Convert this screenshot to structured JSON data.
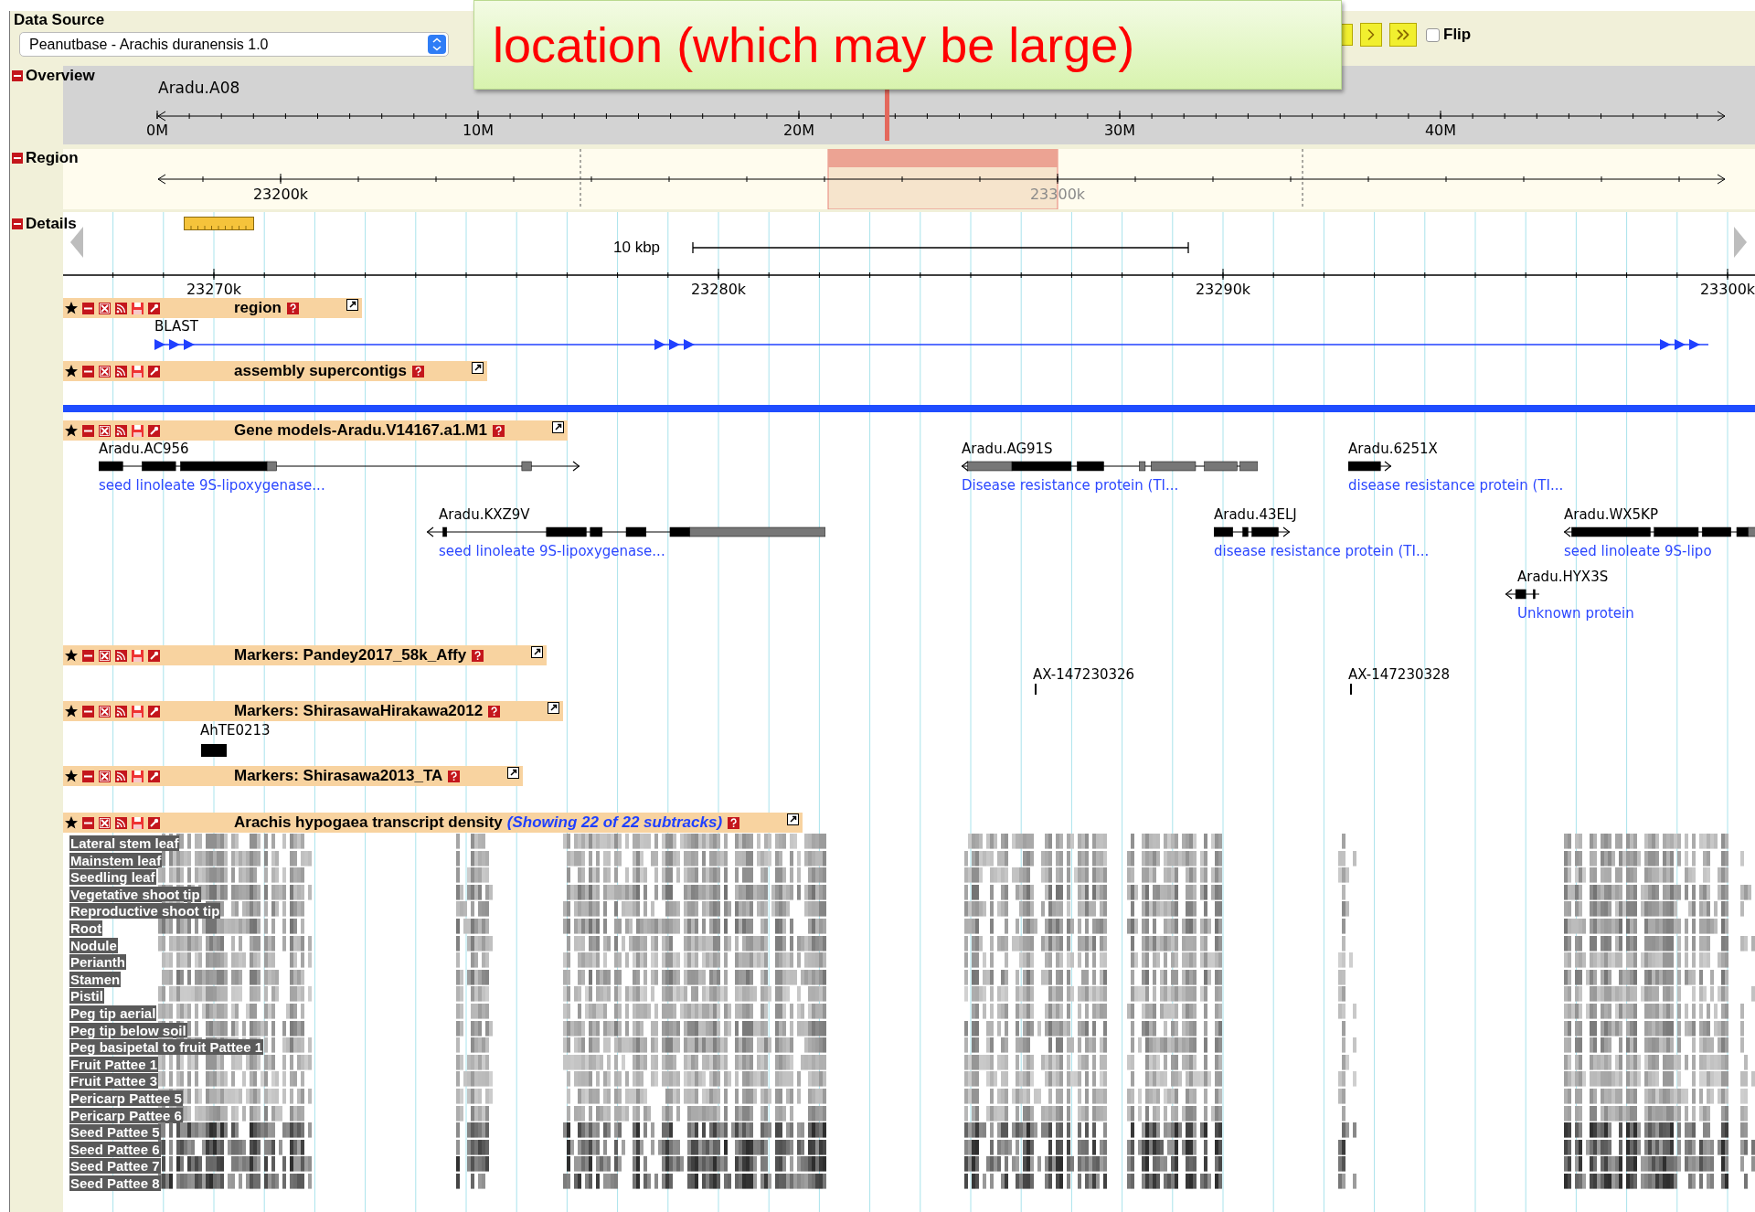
{
  "data_source": {
    "label": "Data Source",
    "value": "Peanutbase - Arachis duranensis 1.0"
  },
  "callout": {
    "text": "location (which may be large)"
  },
  "navigation": {
    "flip": {
      "label": "Flip",
      "checked": false
    }
  },
  "overview": {
    "title": "Overview",
    "expanded": true,
    "chromosome": "Aradu.A08",
    "ticks": [
      "0M",
      "10M",
      "20M",
      "30M",
      "40M"
    ]
  },
  "region": {
    "title": "Region",
    "expanded": true,
    "ticks": [
      "23200k",
      "23300k"
    ]
  },
  "details": {
    "title": "Details",
    "expanded": true,
    "scale": "10 kbp",
    "ticks": [
      "23270k",
      "23280k",
      "23290k",
      "23300k"
    ],
    "tracks": [
      {
        "kind": "blast",
        "title": "region",
        "features": [
          {
            "name": "BLAST"
          }
        ]
      },
      {
        "kind": "contigs",
        "title": "assembly supercontigs"
      },
      {
        "kind": "genes",
        "title": "Gene models-Aradu.V14167.a1.M1",
        "features": [
          {
            "name": "Aradu.AC956",
            "description": "seed linoleate 9S-lipoxygenase...",
            "reverse": false
          },
          {
            "name": "Aradu.KXZ9V",
            "description": "seed linoleate 9S-lipoxygenase...",
            "reverse": true
          },
          {
            "name": "Aradu.AG91S",
            "description": "Disease resistance protein (TI...",
            "reverse": true
          },
          {
            "name": "Aradu.6251X",
            "description": "disease resistance protein (TI...",
            "reverse": false
          },
          {
            "name": "Aradu.43ELJ",
            "description": "disease resistance protein (TI...",
            "reverse": false
          },
          {
            "name": "Aradu.WX5KP",
            "description": "seed linoleate 9S-lipo",
            "reverse": true
          },
          {
            "name": "Aradu.HYX3S",
            "description": "Unknown protein",
            "reverse": true
          }
        ]
      },
      {
        "kind": "markers",
        "title": "Markers: Pandey2017_58k_Affy",
        "features": [
          {
            "name": "AX-147230326"
          },
          {
            "name": "AX-147230328"
          }
        ]
      },
      {
        "kind": "markers",
        "title": "Markers: ShirasawaHirakawa2012",
        "features": [
          {
            "name": "AhTE0213"
          }
        ]
      },
      {
        "kind": "markers",
        "title": "Markers: Shirasawa2013_TA"
      },
      {
        "kind": "density",
        "title": "Arachis hypogaea transcript density",
        "subtitle": "(Showing 22 of 22 subtracks)",
        "subtracks": [
          "Lateral stem leaf",
          "Mainstem leaf",
          "Seedling leaf",
          "Vegetative shoot tip",
          "Reproductive shoot tip",
          "Root",
          "Nodule",
          "Perianth",
          "Stamen",
          "Pistil",
          "Peg tip aerial",
          "Peg tip below soil",
          "Peg basipetal to fruit Pattee 1",
          "Fruit Pattee 1",
          "Fruit Pattee 3",
          "Pericarp Pattee 5",
          "Pericarp Pattee 6",
          "Seed Pattee 5",
          "Seed Pattee 6",
          "Seed Pattee 7",
          "Seed Pattee 8"
        ]
      }
    ]
  }
}
